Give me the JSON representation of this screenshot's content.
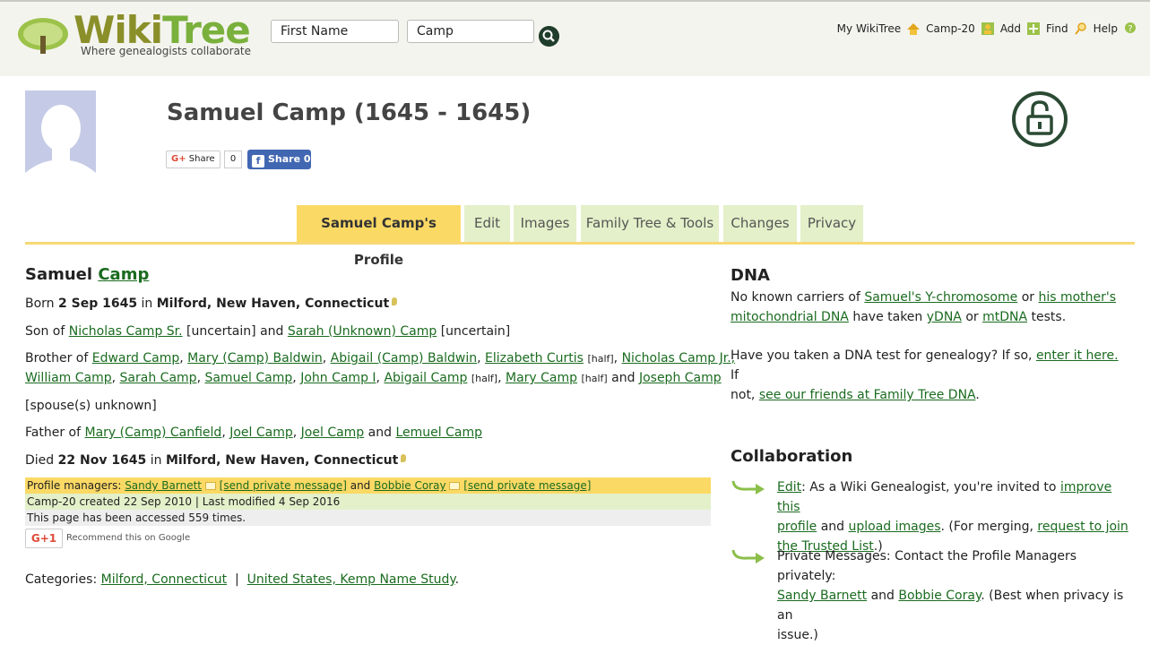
{
  "header": {
    "logo_word_1": "Wiki",
    "logo_word_2": "Tree",
    "logo_tagline": "Where genealogists collaborate",
    "first_name_placeholder": "First Name",
    "last_name_value": "Camp",
    "nav": [
      {
        "label": "My WikiTree",
        "icon": "house-icon"
      },
      {
        "label": "Camp-20",
        "icon": "profile-icon"
      },
      {
        "label": "Add",
        "icon": "plus-icon"
      },
      {
        "label": "Find",
        "icon": "magnifier-icon"
      },
      {
        "label": "Help",
        "icon": "help-icon"
      }
    ]
  },
  "profile": {
    "title": "Samuel Camp (1645 - 1645)",
    "gshare_label": "Share",
    "gshare_count": "0",
    "fb_share_label": "Share 0"
  },
  "tabs": [
    {
      "label": "Samuel Camp's Profile",
      "active": true
    },
    {
      "label": "Edit"
    },
    {
      "label": "Images"
    },
    {
      "label": "Family Tree & Tools"
    },
    {
      "label": "Changes"
    },
    {
      "label": "Privacy"
    }
  ],
  "bio": {
    "first_name": "Samuel",
    "last_name": "Camp",
    "born_prefix": "Born",
    "born_date": "2 Sep 1645",
    "born_in": "in",
    "born_place": "Milford, New Haven, Connecticut",
    "son_of_prefix": "Son of",
    "father": "Nicholas Camp Sr.",
    "uncertain": "[uncertain]",
    "and": "and",
    "mother": "Sarah (Unknown) Camp",
    "brother_of_prefix": "Brother of",
    "siblings_line1": [
      "Edward Camp",
      "Mary (Camp) Baldwin",
      "Abigail (Camp) Baldwin",
      "Elizabeth Curtis",
      "Nicholas Camp Jr.,"
    ],
    "siblings_line2": [
      "William Camp",
      "Sarah Camp",
      "Samuel Camp",
      "John Camp I",
      "Abigail Camp",
      "Mary Camp",
      "Joseph Camp"
    ],
    "half": "[half]",
    "spouses": "[spouse(s) unknown]",
    "father_of_prefix": "Father of",
    "children": [
      "Mary (Camp) Canfield",
      "Joel Camp",
      "Joel Camp",
      "Lemuel Camp"
    ],
    "died_prefix": "Died",
    "died_date": "22 Nov 1645",
    "died_place": "Milford, New Haven, Connecticut"
  },
  "meta": {
    "managers_prefix": "Profile managers:",
    "manager1": "Sandy Barnett",
    "send_pm": "[send private message]",
    "manager2": "Bobbie Coray",
    "created": "Camp-20 created 22 Sep 2010 | Last modified 4 Sep 2016",
    "accessed": "This page has been accessed 559 times.",
    "gplus_label": "G+1",
    "gplus_recommend": "Recommend this on Google",
    "categories_prefix": "Categories:",
    "category1": "Milford, Connecticut",
    "category2": "United States, Kemp Name Study"
  },
  "dna": {
    "heading": "DNA",
    "p1_a": "No known carriers of",
    "p1_link1": "Samuel's Y-chromosome",
    "p1_b": "or",
    "p1_link2a": "his mother's",
    "p1_link2b": "mitochondrial DNA",
    "p1_c": "have taken",
    "p1_link3": "yDNA",
    "p1_d": "or",
    "p1_link4": "mtDNA",
    "p1_e": "tests.",
    "p2_a": "Have you taken a DNA test for genealogy? If so,",
    "p2_link1": "enter it here.",
    "p2_b": "If",
    "p2_c": "not,",
    "p2_link2": "see our friends at Family Tree DNA",
    "p2_d": "."
  },
  "collab": {
    "heading": "Collaboration",
    "item1_link1": "Edit",
    "item1_a": ": As a Wiki Genealogist, you're invited to",
    "item1_link2a": "improve this",
    "item1_link2b": "profile",
    "item1_b": "and",
    "item1_link3": "upload images",
    "item1_c": ". (For merging,",
    "item1_link4a": "request to join",
    "item1_link4b": "the Trusted List",
    "item1_d": ".)",
    "item2_a": "Private Messages: Contact the Profile Managers privately:",
    "item2_link1": "Sandy Barnett",
    "item2_b": "and",
    "item2_link2": "Bobbie Coray",
    "item2_c": ". (Best when privacy is an",
    "item2_d": "issue.)"
  },
  "colors": {
    "accent_green": "#1a6b1f",
    "tab_active": "#fbd965",
    "tab_inactive": "#e3f0c9"
  }
}
